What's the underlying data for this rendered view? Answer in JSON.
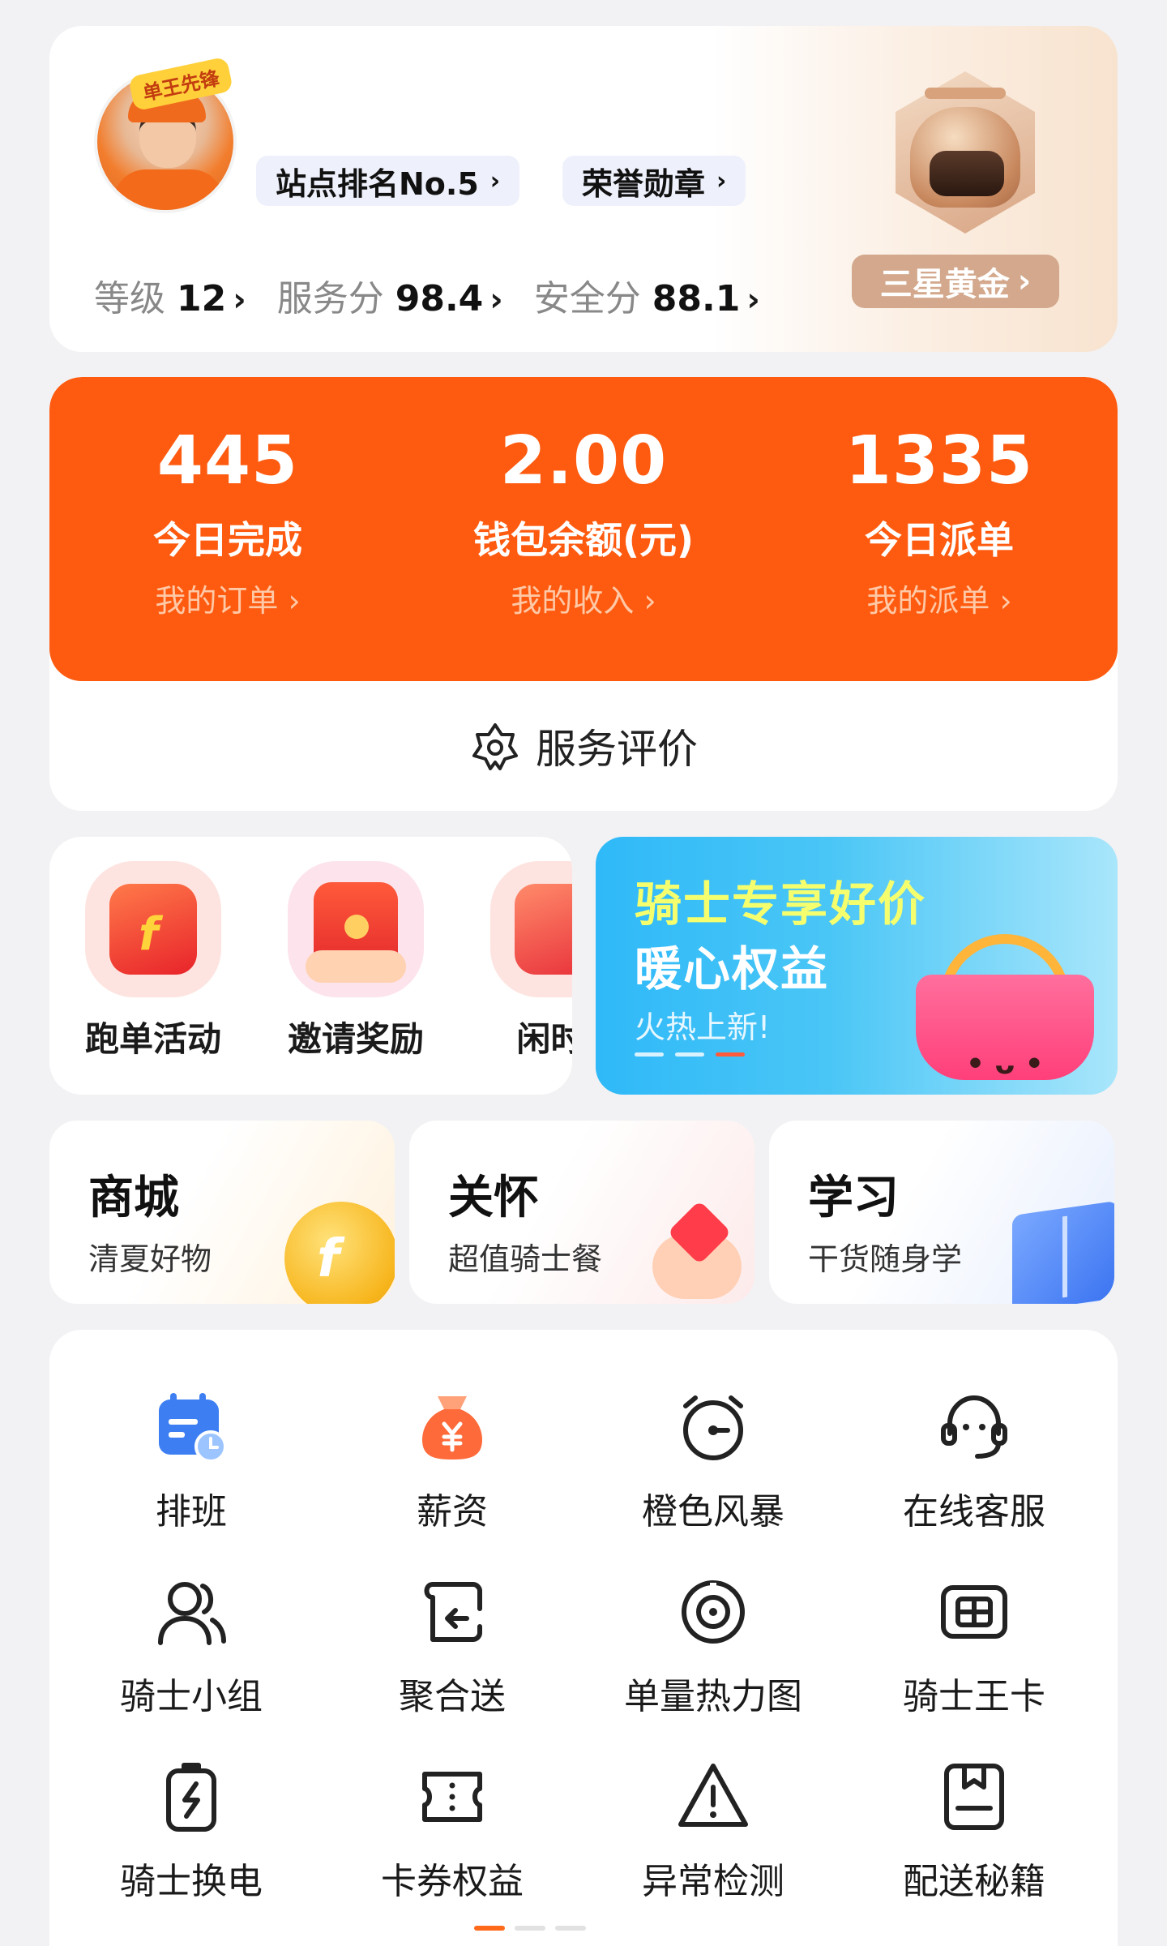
{
  "profile": {
    "avatar_tag": "单王先锋",
    "rank_chip": "站点排名No.5",
    "honor_chip": "荣誉勋章",
    "scores": [
      {
        "label": "等级",
        "value": "12"
      },
      {
        "label": "服务分",
        "value": "98.4"
      },
      {
        "label": "安全分",
        "value": "88.1"
      }
    ],
    "tier": "三星黄金"
  },
  "stats": [
    {
      "value": "445",
      "label": "今日完成",
      "link": "我的订单"
    },
    {
      "value": "2.00",
      "label": "钱包余额(元)",
      "link": "我的收入"
    },
    {
      "value": "1335",
      "label": "今日派单",
      "link": "我的派单"
    }
  ],
  "rating_label": "服务评价",
  "activities": [
    {
      "label": "跑单活动"
    },
    {
      "label": "邀请奖励"
    },
    {
      "label": "闲时!"
    }
  ],
  "promo": {
    "title": "骑士专享好价",
    "subtitle": "暖心权益",
    "tag": "火热上新!"
  },
  "tiles": [
    {
      "title": "商城",
      "subtitle": "清夏好物"
    },
    {
      "title": "关怀",
      "subtitle": "超值骑士餐"
    },
    {
      "title": "学习",
      "subtitle": "干货随身学"
    }
  ],
  "services": [
    {
      "label": "排班",
      "icon": "schedule-icon"
    },
    {
      "label": "薪资",
      "icon": "salary-bag-icon"
    },
    {
      "label": "橙色风暴",
      "icon": "alarm-clock-icon"
    },
    {
      "label": "在线客服",
      "icon": "headset-icon"
    },
    {
      "label": "骑士小组",
      "icon": "group-icon"
    },
    {
      "label": "聚合送",
      "icon": "merge-icon"
    },
    {
      "label": "单量热力图",
      "icon": "target-icon"
    },
    {
      "label": "骑士王卡",
      "icon": "sim-card-icon"
    },
    {
      "label": "骑士换电",
      "icon": "battery-swap-icon"
    },
    {
      "label": "卡券权益",
      "icon": "coupon-icon"
    },
    {
      "label": "异常检测",
      "icon": "warning-icon"
    },
    {
      "label": "配送秘籍",
      "icon": "book-bookmark-icon"
    }
  ],
  "colors": {
    "accent_orange": "#fe5b10",
    "schedule_blue": "#3d7ff2",
    "salary_orange": "#ff6a3a"
  }
}
